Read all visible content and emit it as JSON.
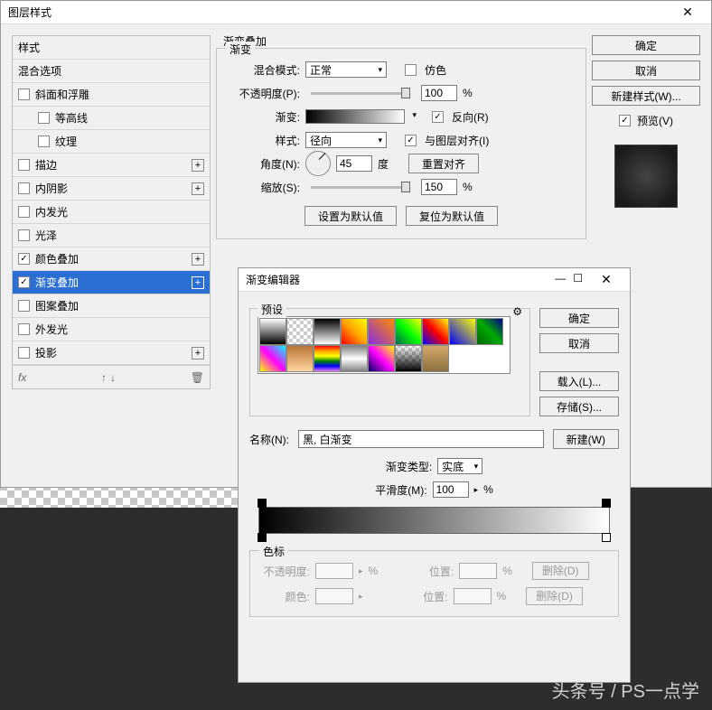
{
  "mainDialog": {
    "title": "图层样式",
    "styles": {
      "header": "样式",
      "blend": "混合选项",
      "items": [
        {
          "label": "斜面和浮雕",
          "checked": false,
          "add": false
        },
        {
          "label": "等高线",
          "checked": false,
          "add": false,
          "sub": true
        },
        {
          "label": "纹理",
          "checked": false,
          "add": false,
          "sub": true
        },
        {
          "label": "描边",
          "checked": false,
          "add": true
        },
        {
          "label": "内阴影",
          "checked": false,
          "add": true
        },
        {
          "label": "内发光",
          "checked": false,
          "add": false
        },
        {
          "label": "光泽",
          "checked": false,
          "add": false
        },
        {
          "label": "颜色叠加",
          "checked": true,
          "add": true
        },
        {
          "label": "渐变叠加",
          "checked": true,
          "add": true,
          "selected": true
        },
        {
          "label": "图案叠加",
          "checked": false,
          "add": false
        },
        {
          "label": "外发光",
          "checked": false,
          "add": false
        },
        {
          "label": "投影",
          "checked": false,
          "add": true
        }
      ],
      "fx": "fx"
    },
    "settings": {
      "title": "渐变叠加",
      "subtitle": "渐变",
      "blendMode": {
        "label": "混合模式:",
        "value": "正常",
        "dither": "仿色"
      },
      "opacity": {
        "label": "不透明度(P):",
        "value": "100",
        "unit": "%"
      },
      "gradient": {
        "label": "渐变:",
        "reverse": "反向(R)"
      },
      "style": {
        "label": "样式:",
        "value": "径向",
        "align": "与图层对齐(I)"
      },
      "angle": {
        "label": "角度(N):",
        "value": "45",
        "unit": "度",
        "reset": "重置对齐"
      },
      "scale": {
        "label": "缩放(S):",
        "value": "150",
        "unit": "%"
      },
      "default1": "设置为默认值",
      "default2": "复位为默认值"
    },
    "buttons": {
      "ok": "确定",
      "cancel": "取消",
      "newStyle": "新建样式(W)...",
      "preview": "预览(V)"
    }
  },
  "gradEditor": {
    "title": "渐变编辑器",
    "presets": "预设",
    "ok": "确定",
    "cancel": "取消",
    "load": "载入(L)...",
    "save": "存储(S)...",
    "nameLabel": "名称(N):",
    "nameValue": "黑, 白渐变",
    "new": "新建(W)",
    "typeLabel": "渐变类型:",
    "typeValue": "实底",
    "smoothLabel": "平滑度(M):",
    "smoothValue": "100",
    "smoothUnit": "%",
    "stops": {
      "title": "色标",
      "opacity": "不透明度:",
      "position": "位置:",
      "color": "颜色:",
      "delete": "删除(D)",
      "pct": "%"
    }
  },
  "watermark": "头条号 / PS一点学"
}
